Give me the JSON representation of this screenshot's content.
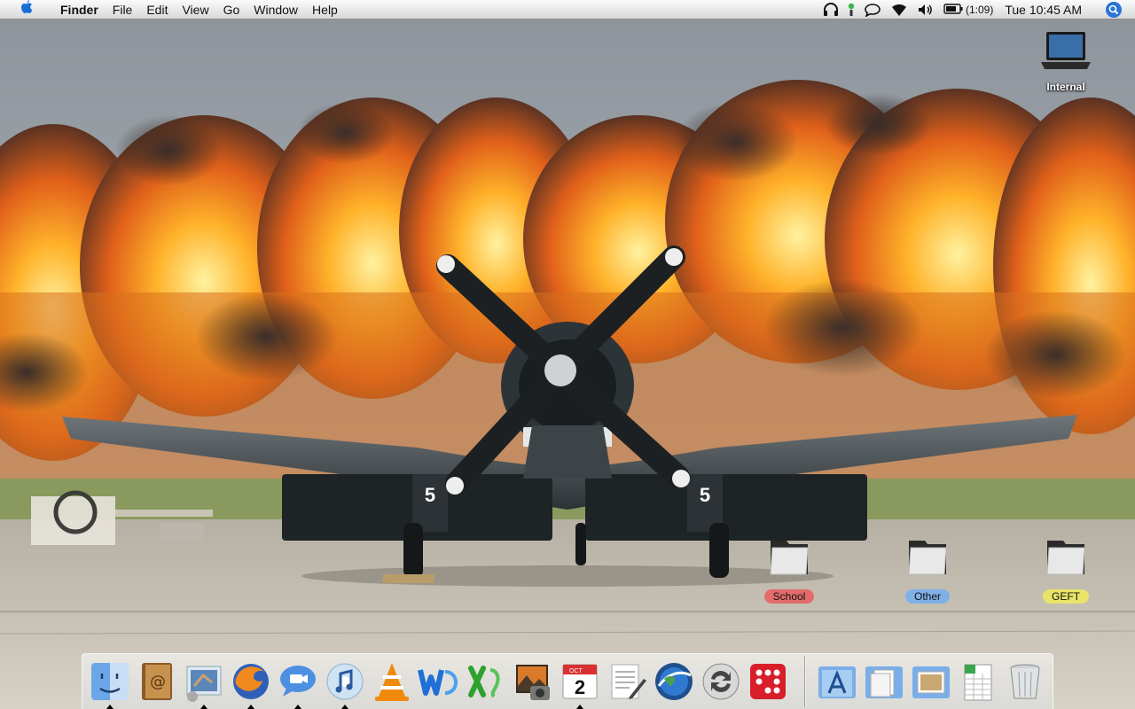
{
  "menubar": {
    "app_name": "Finder",
    "menus": [
      "File",
      "Edit",
      "View",
      "Go",
      "Window",
      "Help"
    ],
    "battery_time": "(1:09)",
    "clock": "Tue 10:45 AM",
    "status_icons": [
      "headphones-icon",
      "ichat-status-icon",
      "speech-bubble-icon",
      "wifi-icon",
      "volume-icon",
      "battery-icon",
      "spotlight-icon"
    ]
  },
  "desktop": {
    "drive": {
      "label": "Internal",
      "icon": "laptop-icon"
    },
    "folders": [
      {
        "label": "School",
        "label_color": "#e36b6b"
      },
      {
        "label": "Other",
        "label_color": "#7fb0e8"
      },
      {
        "label": "GEFT",
        "label_color": "#e8e46a"
      }
    ]
  },
  "dock": {
    "apps": [
      {
        "name": "Finder",
        "icon": "finder-icon",
        "running": true
      },
      {
        "name": "Address Book",
        "icon": "address-book-icon",
        "running": false
      },
      {
        "name": "Mail",
        "icon": "mail-icon",
        "running": true
      },
      {
        "name": "Firefox",
        "icon": "firefox-icon",
        "running": true
      },
      {
        "name": "iChat",
        "icon": "ichat-icon",
        "running": true
      },
      {
        "name": "iTunes",
        "icon": "itunes-icon",
        "running": true
      },
      {
        "name": "VLC",
        "icon": "vlc-icon",
        "running": false
      },
      {
        "name": "Word",
        "icon": "word-icon",
        "running": false
      },
      {
        "name": "Excel",
        "icon": "excel-icon",
        "running": false
      },
      {
        "name": "iPhoto",
        "icon": "iphoto-icon",
        "running": false
      },
      {
        "name": "iCal",
        "icon": "ical-icon",
        "running": true,
        "month": "OCT",
        "day": "2"
      },
      {
        "name": "TextEdit",
        "icon": "textedit-icon",
        "running": false
      },
      {
        "name": "Google Earth",
        "icon": "google-earth-icon",
        "running": false
      },
      {
        "name": "Sync",
        "icon": "sync-icon",
        "running": false
      },
      {
        "name": "Sudoku",
        "icon": "dice-app-icon",
        "running": false
      }
    ],
    "stacks": [
      {
        "name": "Applications",
        "icon": "applications-stack-icon"
      },
      {
        "name": "Documents",
        "icon": "documents-stack-icon"
      },
      {
        "name": "Pictures",
        "icon": "pictures-stack-icon"
      },
      {
        "name": "Spreadsheet",
        "icon": "spreadsheet-icon"
      },
      {
        "name": "Trash",
        "icon": "trash-icon"
      }
    ]
  }
}
